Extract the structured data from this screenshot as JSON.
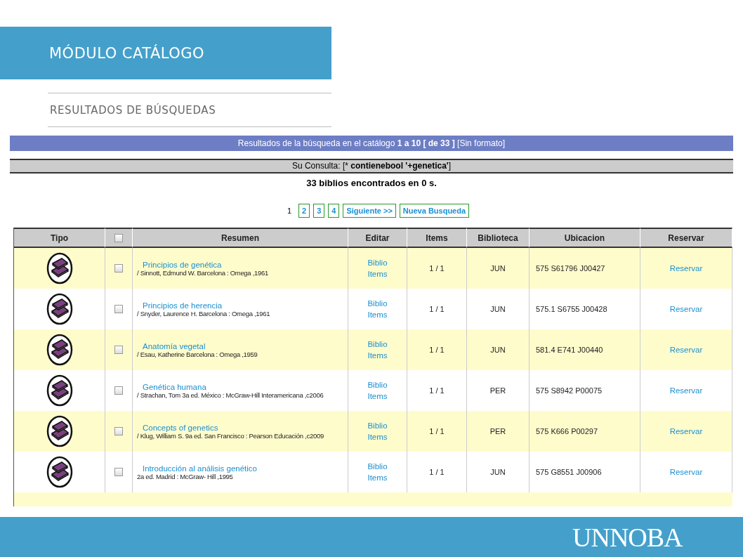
{
  "slide": {
    "title": "MÓDULO CATÁLOGO",
    "subtitle": "RESULTADOS DE BÚSQUEDAS",
    "logo": "UNNOBA"
  },
  "results_bar": "Resultados de la búsqueda en el catálogo  **1 a 10 [ de 33 ]** [Sin formato]",
  "query_bar": "Su Consulta: [* **contienebool '+genetica'**]",
  "found": "33 biblios encontrados en 0 s.",
  "pages": [
    {
      "label": "1",
      "selected": true
    },
    {
      "label": "2",
      "selected": false
    },
    {
      "label": "3",
      "selected": false
    },
    {
      "label": "4",
      "selected": false
    }
  ],
  "nav_buttons": [
    "Siguiente >>",
    "Nueva Busqueda"
  ],
  "table": {
    "columns": [
      "Tipo",
      "",
      "Resumen",
      "Editar",
      "Items",
      "Biblioteca",
      "Ubicacion",
      "Reservar"
    ],
    "select_all_checked": false,
    "rows": [
      {
        "title": "Principios de genética",
        "detail": "/ Sinnott, Edmund W.  Barcelona  : Omega ,1961",
        "edit": [
          "Biblio",
          "Items"
        ],
        "items": "1 / 1",
        "library": "JUN",
        "location": "575 S61796 J00427",
        "reserve": "Reservar",
        "checked": false
      },
      {
        "title": "Principios de herencia",
        "detail": "/ Snyder, Laurence H.  Barcelona  : Omega ,1961",
        "edit": [
          "Biblio",
          "Items"
        ],
        "items": "1 / 1",
        "library": "JUN",
        "location": "575.1 S6755 J00428",
        "reserve": "Reservar",
        "checked": false
      },
      {
        "title": "Anatomía vegetal",
        "detail": "/ Esau, Katherine  Barcelona  : Omega ,1959",
        "edit": [
          "Biblio",
          "Items"
        ],
        "items": "1 / 1",
        "library": "JUN",
        "location": "581.4 E741 J00440",
        "reserve": "Reservar",
        "checked": false
      },
      {
        "title": "Genética humana",
        "detail": "/ Strachan, Tom  3a ed.  México  : McGraw-Hill Interamericana ,c2006",
        "edit": [
          "Biblio",
          "Items"
        ],
        "items": "1 / 1",
        "library": "PER",
        "location": "575 S8942 P00075",
        "reserve": "Reservar",
        "checked": false
      },
      {
        "title": "Concepts of genetics",
        "detail": "/ Klug, William S.  9a ed.  San Francisco  : Pearson Educación ,c2009",
        "edit": [
          "Biblio",
          "Items"
        ],
        "items": "1 / 1",
        "library": "PER",
        "location": "575 K666 P00297",
        "reserve": "Reservar",
        "checked": false
      },
      {
        "title": "Introducción al análisis genético",
        "detail": "2a ed.  Madrid  : McGraw- Hill ,1995",
        "edit": [
          "Biblio",
          "Items"
        ],
        "items": "1 / 1",
        "library": "JUN",
        "location": "575 G8551 J00906",
        "reserve": "Reservar",
        "checked": false
      }
    ]
  }
}
